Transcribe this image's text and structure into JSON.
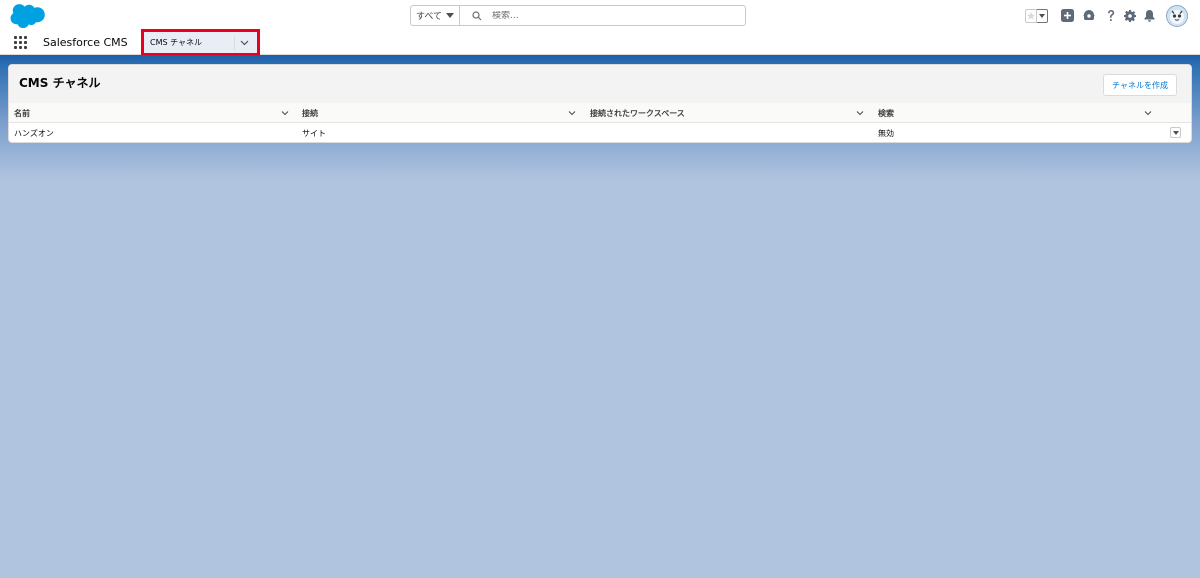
{
  "global_header": {
    "search_scope": "すべて",
    "search_placeholder": "検索..."
  },
  "app_bar": {
    "app_name": "Salesforce CMS",
    "nav_item_label": "CMS チャネル"
  },
  "card": {
    "title": "CMS チャネル",
    "new_button": "チャネルを作成",
    "columns": [
      "名前",
      "接続",
      "接続されたワークスペース",
      "検索"
    ],
    "rows": [
      [
        "ハンズオン",
        "サイト",
        "",
        "無効"
      ]
    ]
  },
  "colors": {
    "brand_blue": "#1b5ea8",
    "logo_blue": "#00a1e0",
    "highlight_red": "#ea001e",
    "link_blue": "#0176d3"
  }
}
